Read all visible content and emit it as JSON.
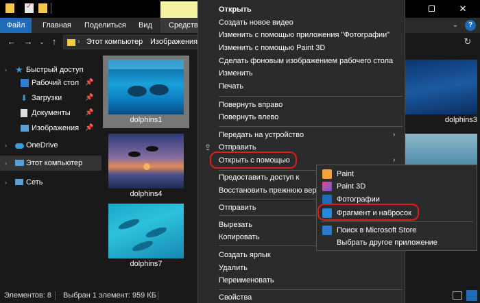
{
  "ribbon": {
    "file": "Файл",
    "main": "Главная",
    "share": "Поделиться",
    "view": "Вид",
    "tools": "Средства"
  },
  "address": {
    "computer": "Этот компьютер",
    "images": "Изображения",
    "separator": "›"
  },
  "sidebar": {
    "items": [
      {
        "label": "Быстрый доступ",
        "icon": "star-icon"
      },
      {
        "label": "Рабочий стол",
        "icon": "desktop-folder-icon"
      },
      {
        "label": "Загрузки",
        "icon": "downloads-icon"
      },
      {
        "label": "Документы",
        "icon": "documents-icon"
      },
      {
        "label": "Изображения",
        "icon": "pictures-icon"
      },
      {
        "label": "OneDrive",
        "icon": "onedrive-icon"
      },
      {
        "label": "Этот компьютер",
        "icon": "computer-icon"
      },
      {
        "label": "Сеть",
        "icon": "network-icon"
      }
    ]
  },
  "files": [
    {
      "name": "dolphins1",
      "selected": true
    },
    {
      "name": "dolphins4",
      "selected": false
    },
    {
      "name": "dolphins7",
      "selected": false
    },
    {
      "name": "dolphins3",
      "selected": false
    }
  ],
  "status": {
    "count": "Элементов: 8",
    "selection": "Выбран 1 элемент: 959 КБ"
  },
  "context_menu": {
    "items": [
      {
        "label": "Открыть",
        "bold": true
      },
      {
        "label": "Создать новое видео"
      },
      {
        "label": "Изменить с помощью приложения \"Фотографии\""
      },
      {
        "label": "Изменить с помощью Paint 3D"
      },
      {
        "label": "Сделать фоновым изображением рабочего стола"
      },
      {
        "label": "Изменить"
      },
      {
        "label": "Печать"
      },
      {
        "label": "Повернуть вправо"
      },
      {
        "label": "Повернуть влево"
      },
      {
        "label": "Передать на устройство"
      },
      {
        "label": "Отправить"
      },
      {
        "label": "Открыть с помощью"
      },
      {
        "label": "Предоставить доступ к"
      },
      {
        "label": "Восстановить прежнюю версию"
      },
      {
        "label": "Отправить"
      },
      {
        "label": "Вырезать"
      },
      {
        "label": "Копировать"
      },
      {
        "label": "Создать ярлык"
      },
      {
        "label": "Удалить"
      },
      {
        "label": "Переименовать"
      },
      {
        "label": "Свойства"
      }
    ]
  },
  "submenu": {
    "items": [
      {
        "label": "Paint",
        "icon": "paint-icon"
      },
      {
        "label": "Paint 3D",
        "icon": "paint3d-icon"
      },
      {
        "label": "Фотографии",
        "icon": "photos-icon"
      },
      {
        "label": "Фрагмент и набросок",
        "icon": "snip-sketch-icon"
      },
      {
        "label": "Поиск в Microsoft Store",
        "icon": "store-icon"
      },
      {
        "label": "Выбрать другое приложение",
        "icon": ""
      }
    ]
  },
  "colors": {
    "accent": "#1e6bb8",
    "highlight": "#e01c1c",
    "menu_bg": "#2b2b2b",
    "window_bg": "#191919"
  }
}
